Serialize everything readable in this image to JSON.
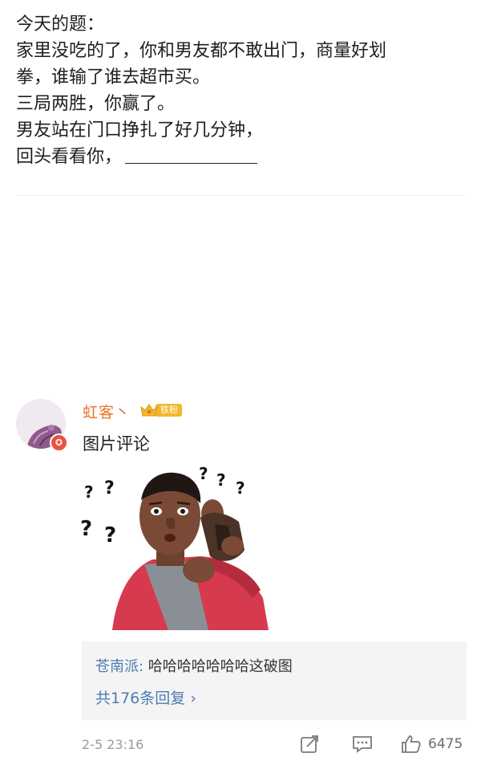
{
  "post": {
    "lines": [
      "今天的题：",
      "家里没吃的了，你和男友都不敢出门，商量好划",
      "拳，谁输了谁去超市买。",
      "三局两胜，你赢了。",
      "男友站在门口挣扎了好几分钟，",
      "回头看看你，"
    ]
  },
  "comment": {
    "username": "虹客丶",
    "fan_badge": "铁粉",
    "text": "图片评论",
    "image_alt_icon": "man-empty-wallet-meme"
  },
  "reply_preview": {
    "user": "苍南派",
    "separator": ":",
    "text": " 哈哈哈哈哈哈哈这破图",
    "count_label": "共176条回复",
    "arrow": "›"
  },
  "footer": {
    "timestamp": "2-5 23:16",
    "like_count": "6475"
  },
  "colors": {
    "username": "#e8742c",
    "link": "#4f7cb0",
    "badge": "#f3b62d"
  }
}
